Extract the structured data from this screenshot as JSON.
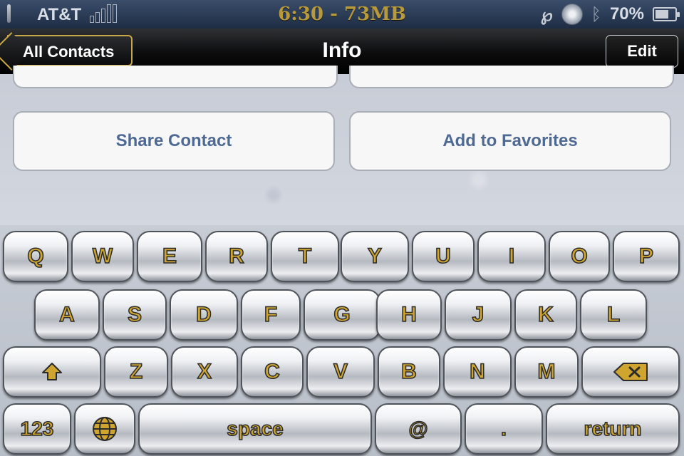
{
  "status_bar": {
    "carrier": "AT&T",
    "clock": "6:30 - 73MB",
    "battery_percent": "70%",
    "battery_level": 0.7,
    "icons": [
      "signal-bars-icon",
      "p-icon",
      "disc-icon",
      "bluetooth-icon",
      "battery-icon"
    ]
  },
  "nav": {
    "back_label": "All Contacts",
    "title": "Info",
    "edit_label": "Edit"
  },
  "content": {
    "share_label": "Share Contact",
    "favorites_label": "Add to Favorites"
  },
  "keyboard": {
    "row1": [
      "Q",
      "W",
      "E",
      "R",
      "T",
      "Y",
      "U",
      "I",
      "O",
      "P"
    ],
    "row2": [
      "A",
      "S",
      "D",
      "F",
      "G",
      "H",
      "J",
      "K",
      "L"
    ],
    "row3": [
      "Z",
      "X",
      "C",
      "V",
      "B",
      "N",
      "M"
    ],
    "numbers": "123",
    "space": "space",
    "at": "@",
    "dot": ".",
    "return": "return",
    "icons": [
      "shift-icon",
      "backspace-icon",
      "globe-icon"
    ]
  },
  "colors": {
    "key_text": "#cfa52f",
    "accent_gold": "#c9a848",
    "button_text": "#4e6a93"
  }
}
